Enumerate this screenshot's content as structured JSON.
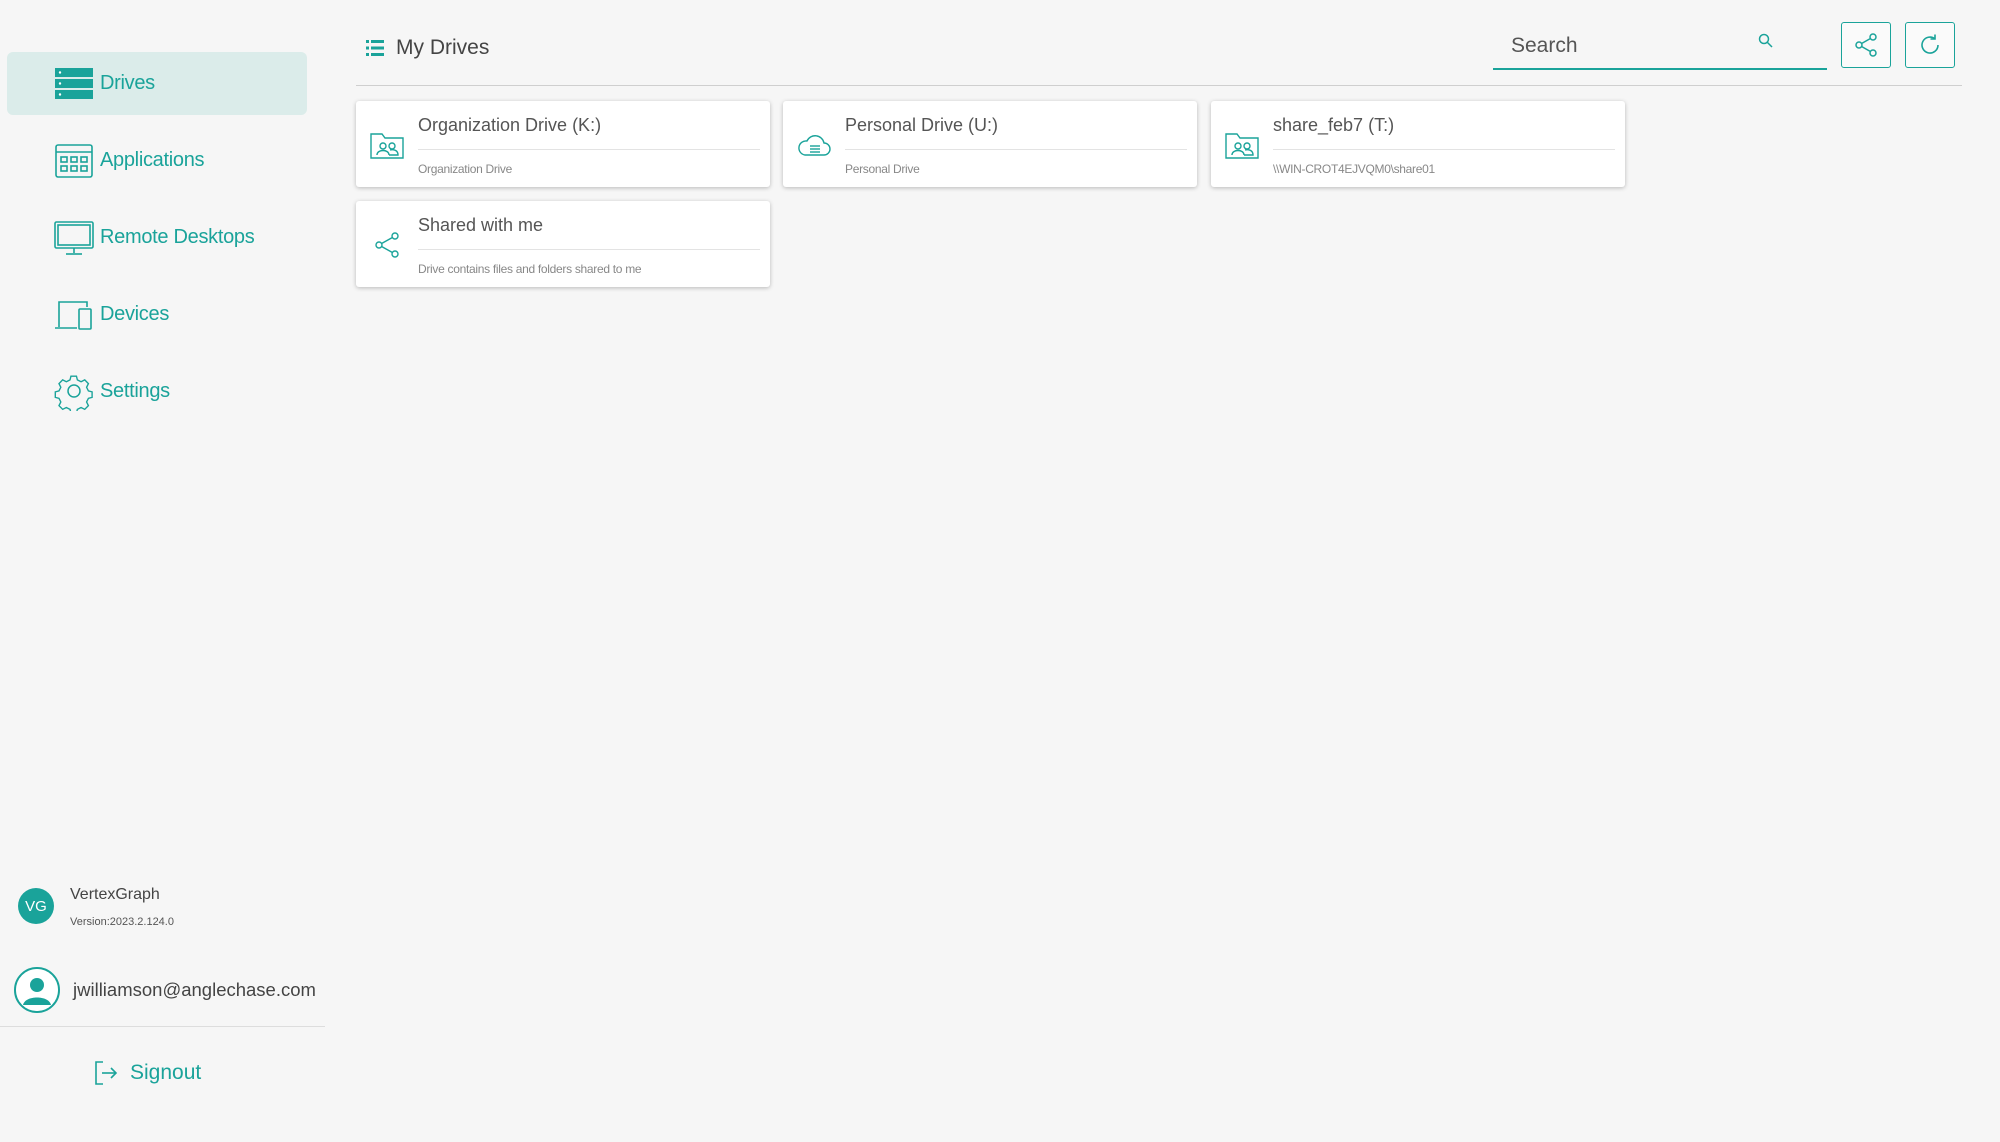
{
  "sidebar": {
    "items": [
      {
        "label": "Drives",
        "icon": "drives-icon",
        "active": true
      },
      {
        "label": "Applications",
        "icon": "applications-icon",
        "active": false
      },
      {
        "label": "Remote Desktops",
        "icon": "monitor-icon",
        "active": false
      },
      {
        "label": "Devices",
        "icon": "devices-icon",
        "active": false
      },
      {
        "label": "Settings",
        "icon": "gear-icon",
        "active": false
      }
    ],
    "brand": {
      "logo_text": "VG",
      "name": "VertexGraph",
      "version": "Version:2023.2.124.0"
    },
    "user": {
      "email": "jwilliamson@anglechase.com"
    },
    "signout_label": "Signout"
  },
  "header": {
    "title": "My Drives",
    "search": {
      "placeholder": "Search",
      "value": ""
    }
  },
  "drives": [
    {
      "title": "Organization Drive (K:)",
      "subtitle": "Organization Drive",
      "icon": "shared-folder-icon"
    },
    {
      "title": "Personal Drive (U:)",
      "subtitle": "Personal Drive",
      "icon": "cloud-drive-icon"
    },
    {
      "title": "share_feb7 (T:)",
      "subtitle": "\\\\WIN-CROT4EJVQM0\\share01",
      "icon": "shared-folder-icon"
    },
    {
      "title": "Shared with me",
      "subtitle": "Drive contains files and folders shared to me",
      "icon": "share-icon"
    }
  ],
  "colors": {
    "accent": "#1aa39a",
    "active_bg": "#dbecea",
    "background": "#f6f6f6"
  }
}
